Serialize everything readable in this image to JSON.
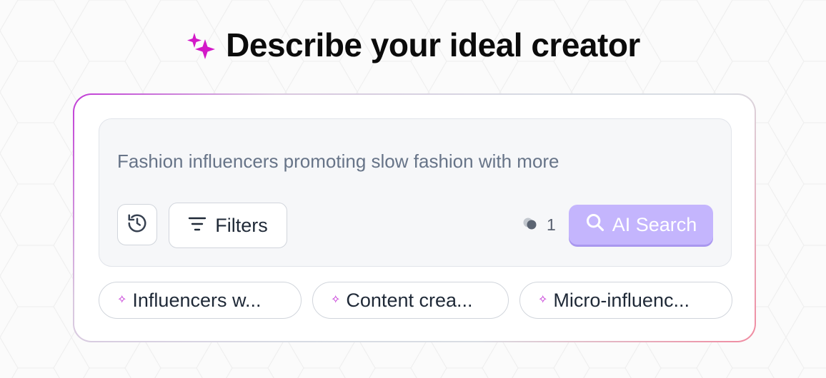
{
  "header": {
    "title": "Describe your ideal creator",
    "icon": "sparkles-icon",
    "icon_color": "#d319c8"
  },
  "search": {
    "query": "Fashion influencers promoting slow fashion with more",
    "history_icon": "history-icon",
    "filters_label": "Filters",
    "filters_icon": "filter-lines-icon",
    "credits_icon": "coins-icon",
    "credits_count": "1",
    "ai_search_label": "AI Search",
    "ai_search_icon": "search-icon",
    "ai_search_color": "#c4b5fd"
  },
  "suggestions": [
    {
      "label": "Influencers w...",
      "icon": "sparkle-icon"
    },
    {
      "label": "Content crea...",
      "icon": "sparkle-icon"
    },
    {
      "label": "Micro-influenc...",
      "icon": "sparkle-icon"
    }
  ]
}
